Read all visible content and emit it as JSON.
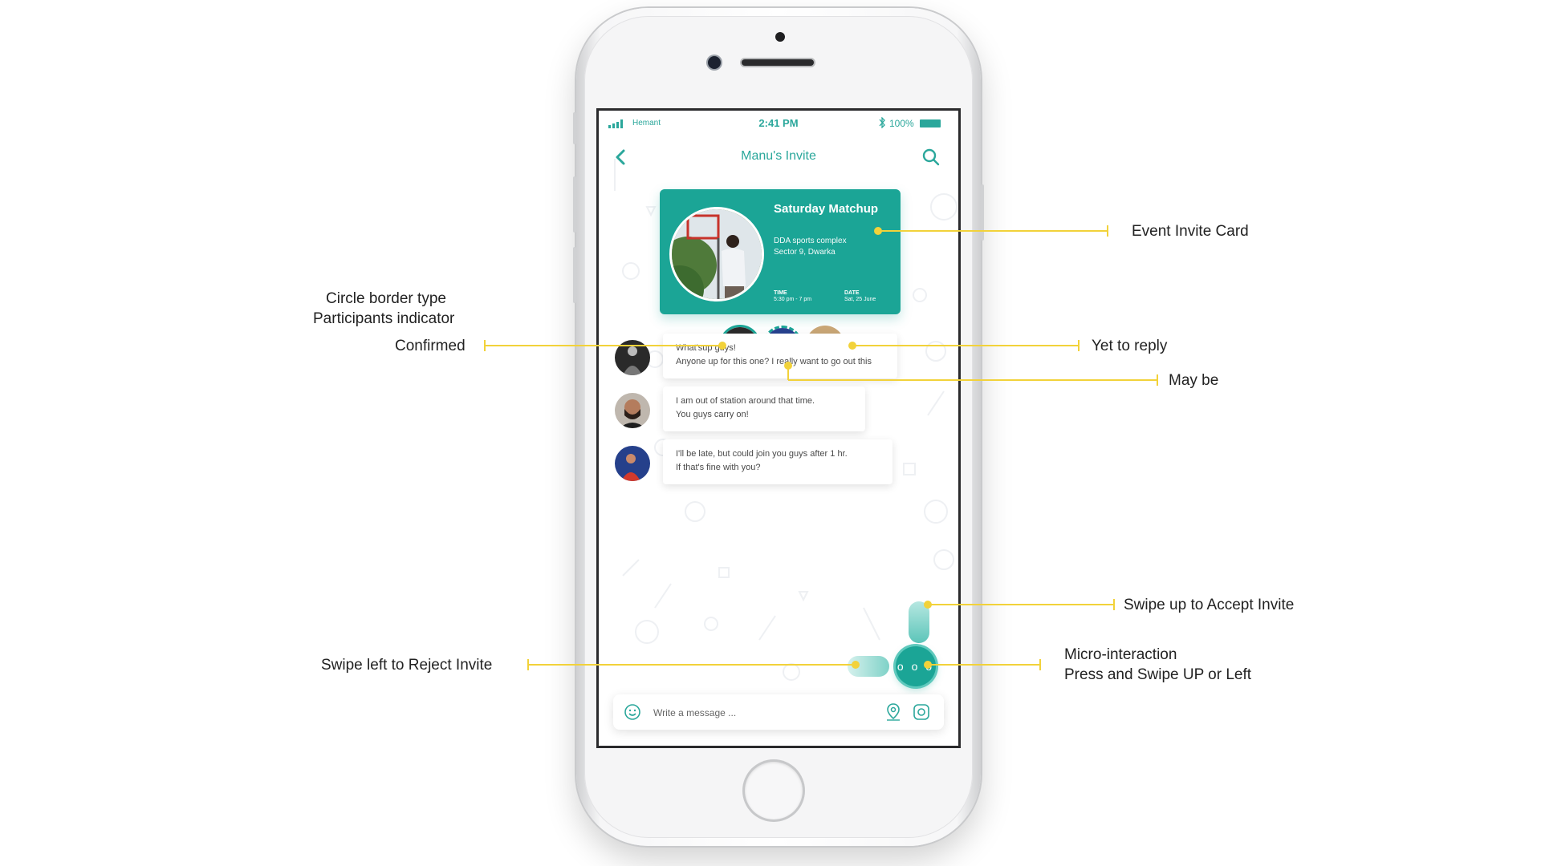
{
  "status_bar": {
    "carrier": "Hemant",
    "time": "2:41 PM",
    "battery": "100%"
  },
  "nav": {
    "title": "Manu's Invite"
  },
  "event_card": {
    "title": "Saturday Matchup",
    "venue_line1": "DDA sports complex",
    "venue_line2": "Sector 9, Dwarka",
    "time_label": "TIME",
    "time_value": "5:30 pm - 7 pm",
    "date_label": "DATE",
    "date_value": "Sat, 25 June"
  },
  "messages": [
    {
      "line1": "What'sup guys!",
      "line2": "Anyone up for this one? I really want to go out this"
    },
    {
      "line1": "I am out of station around that time.",
      "line2": "You guys carry on!"
    },
    {
      "line1": "I'll be late, but could join you guys after 1 hr.",
      "line2": "If that's fine with you?"
    }
  ],
  "micro_button": {
    "glyph": "o o o"
  },
  "input": {
    "placeholder": "Write a message ..."
  },
  "annotations": {
    "event_invite_card": "Event Invite Card",
    "circle_border_line1": "Circle border type",
    "circle_border_line2": "Participants indicator",
    "confirmed": "Confirmed",
    "yet_to_reply": "Yet to reply",
    "may_be": "May be",
    "swipe_up": "Swipe up to Accept Invite",
    "swipe_left": "Swipe left to Reject Invite",
    "micro_line1": "Micro-interaction",
    "micro_line2": "Press and Swipe UP or Left"
  },
  "colors": {
    "accent": "#1ba596",
    "annotation_line": "#f2d23a",
    "text": "#222222"
  }
}
